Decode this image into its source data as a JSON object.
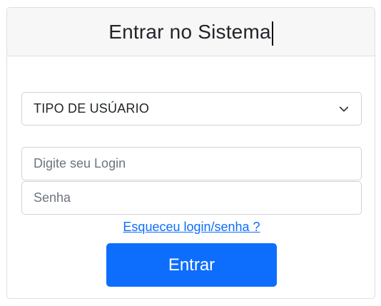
{
  "login_card": {
    "title": "Entrar no Sistema",
    "user_type_select": {
      "selected": "TIPO DE USÚARIO",
      "icon": "chevron-down-icon"
    },
    "login_input": {
      "value": "",
      "placeholder": "Digite seu Login"
    },
    "password_input": {
      "value": "",
      "placeholder": "Senha"
    },
    "forgot_link": "Esqueceu login/senha ?",
    "submit_label": "Entrar"
  },
  "colors": {
    "primary": "#0d6efd",
    "header_bg": "#f7f7f7",
    "border": "#ced4da",
    "text": "#212529",
    "placeholder": "#6c757d"
  }
}
